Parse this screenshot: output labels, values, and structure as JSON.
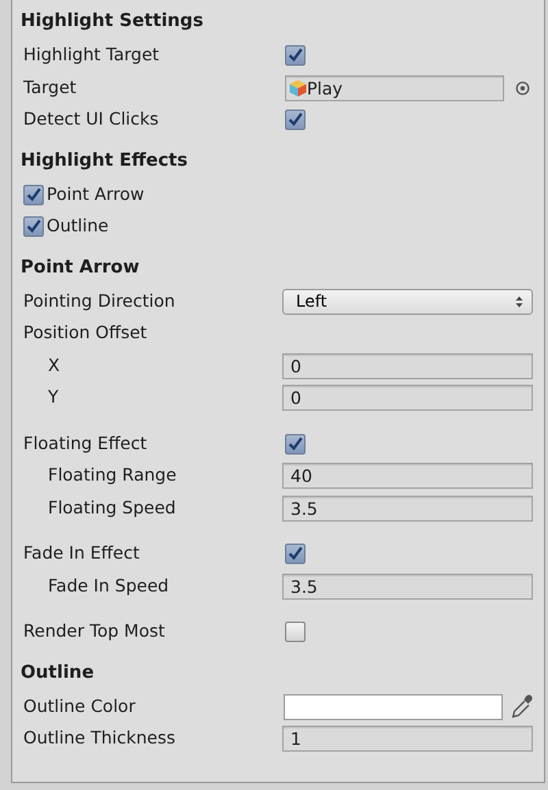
{
  "sections": [
    {
      "title": "Highlight Settings",
      "rows": [
        {
          "kind": "checkbox",
          "label": "Highlight Target",
          "checked": true
        },
        {
          "kind": "object",
          "label": "Target",
          "value": "Play"
        },
        {
          "kind": "checkbox",
          "label": "Detect UI Clicks",
          "checked": true
        }
      ]
    },
    {
      "title": "Highlight Effects",
      "rows": [
        {
          "kind": "toggle",
          "label": "Point Arrow",
          "checked": true
        },
        {
          "kind": "toggle",
          "label": "Outline",
          "checked": true
        }
      ]
    },
    {
      "title": "Point Arrow",
      "rows": [
        {
          "kind": "dropdown",
          "label": "Pointing Direction",
          "value": "Left"
        },
        {
          "kind": "label",
          "label": "Position Offset",
          "children": [
            {
              "kind": "number",
              "label": "X",
              "value": "0"
            },
            {
              "kind": "number",
              "label": "Y",
              "value": "0"
            }
          ]
        },
        {
          "kind": "checkbox",
          "label": "Floating Effect",
          "checked": true,
          "children": [
            {
              "kind": "number",
              "label": "Floating Range",
              "value": "40"
            },
            {
              "kind": "number",
              "label": "Floating Speed",
              "value": "3.5"
            }
          ]
        },
        {
          "kind": "checkbox",
          "label": "Fade In Effect",
          "checked": true,
          "children": [
            {
              "kind": "number",
              "label": "Fade In Speed",
              "value": "3.5"
            }
          ]
        },
        {
          "kind": "checkbox",
          "label": "Render Top Most",
          "checked": false
        }
      ]
    },
    {
      "title": "Outline",
      "rows": [
        {
          "kind": "color",
          "label": "Outline Color",
          "color": "#ffffff"
        },
        {
          "kind": "number",
          "label": "Outline Thickness",
          "value": "1"
        }
      ]
    }
  ]
}
